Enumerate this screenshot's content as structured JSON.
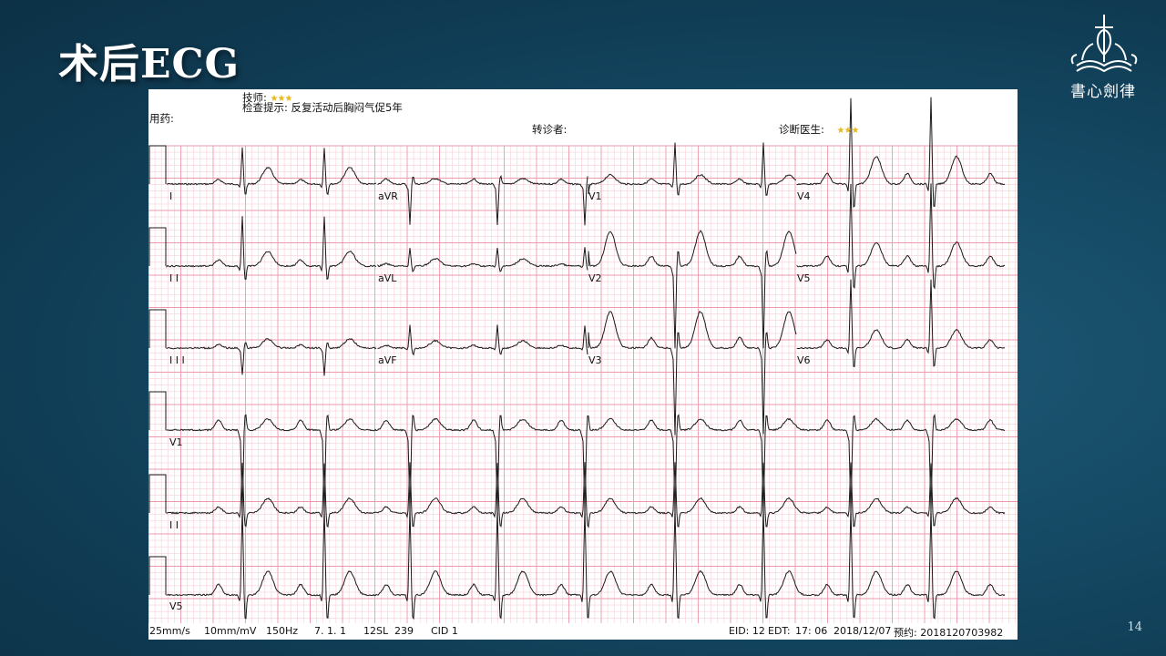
{
  "slide": {
    "title": "术后ECG",
    "page_number": "14",
    "logo_text": "書心劍律"
  },
  "ecg": {
    "header": {
      "technician_label": "技师:",
      "hint_label": "检查提示:",
      "hint_text": "反复活动后胸闷气促5年",
      "medication_label": "用药:",
      "referrer_label": "转诊者:",
      "doctor_label": "诊断医生:",
      "redacted_mark": "★★★"
    },
    "leads": {
      "I": "I",
      "II": "I I",
      "III": "I I I",
      "aVR": "aVR",
      "aVL": "aVL",
      "aVF": "aVF",
      "V1": "V1",
      "V2": "V2",
      "V3": "V3",
      "V4": "V4",
      "V5": "V5",
      "V6": "V6",
      "rhythm_V1": "V1",
      "rhythm_II": "I I",
      "rhythm_V5": "V5"
    },
    "footer": {
      "speed": "25mm/s",
      "gain": "10mm/mV",
      "filter": "150Hz",
      "version": "7. 1. 1",
      "model": "12SL",
      "code": "239",
      "cid": "CID  1",
      "eid": "EID: 12",
      "edt": "EDT:",
      "time": "17: 06",
      "date": "2018/12/07",
      "booking_label": "预约:",
      "booking_number": "2018120703982"
    },
    "colors": {
      "grid_minor": "#f7cfd8",
      "grid_major": "#ee9aac",
      "trace": "#1a1a1a"
    }
  }
}
